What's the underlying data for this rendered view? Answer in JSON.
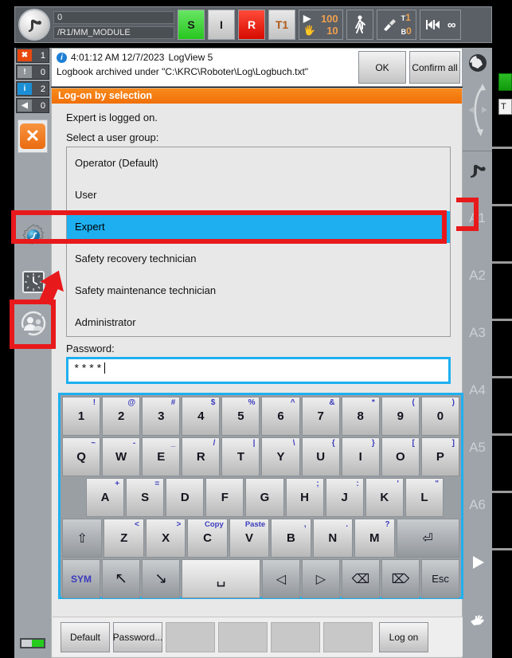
{
  "statusbar": {
    "robot_icon": "kuka-robot-icon",
    "program_number": "0",
    "program_path": "/R1/MM_MODULE",
    "buttons": [
      {
        "name": "submit-interpreter",
        "label": "S",
        "color": "#27c61f",
        "style": "green"
      },
      {
        "name": "drives-i",
        "label": "I",
        "color": "#c2c2c2",
        "style": "grey"
      },
      {
        "name": "drives-r",
        "label": "R",
        "color": "#d60b00",
        "style": "red"
      },
      {
        "name": "operating-mode",
        "label": "T1",
        "color": "#b05a18",
        "style": "mode"
      }
    ],
    "override": {
      "program_icon": "play-icon",
      "program_value": "100",
      "jog_icon": "hand-icon",
      "jog_value": "10"
    },
    "jog_mode_icon": "walking-person-icon",
    "tool_base": {
      "icon": "tool-icon",
      "tool_label": "T",
      "tool_value": "1",
      "base_label": "B",
      "base_value": "0"
    },
    "incremental_icon": "increment-jog-icon",
    "incremental_value": "∞"
  },
  "left_rail": {
    "message_counters": [
      {
        "name": "error-counter",
        "icon": "error-icon",
        "count": "1",
        "kind": "err"
      },
      {
        "name": "warning-counter",
        "icon": "warning-icon",
        "count": "0",
        "kind": "warn"
      },
      {
        "name": "info-counter",
        "icon": "info-icon",
        "count": "2",
        "kind": "info"
      },
      {
        "name": "wait-counter",
        "icon": "wait-icon",
        "count": "0",
        "kind": "wait"
      }
    ],
    "close_button_icon": "close-x-icon",
    "icons": [
      {
        "name": "settings-gear-icon"
      },
      {
        "name": "clock-icon"
      },
      {
        "name": "user-group-icon"
      }
    ],
    "battery_icon": "battery-indicator"
  },
  "right_rail": {
    "globe_icon": "world-coordinates-icon",
    "motion_icon": "reorient-arrows-icon",
    "robot_icon": "robot-axis-icon",
    "axes": [
      "A1",
      "A2",
      "A3",
      "A4",
      "A5",
      "A6"
    ],
    "play_icon": "play-triangle-icon",
    "hand_icon": "jog-hand-icon",
    "green_status": "drives-ready-indicator",
    "t_label": "T"
  },
  "message": {
    "info_icon": "info-icon",
    "timestamp": "4:01:12 AM 12/7/2023",
    "source": "LogView 5",
    "text": "Logbook archived under \"C:\\KRC\\Roboter\\Log\\Logbuch.txt\"",
    "ok_label": "OK",
    "confirm_all_label": "Confirm all"
  },
  "dialog": {
    "title": "Log-on by selection",
    "logged_on_text": "Expert is logged on.",
    "select_label": "Select a user group:",
    "user_groups": [
      {
        "label": "Operator (Default)",
        "selected": false
      },
      {
        "label": "User",
        "selected": false
      },
      {
        "label": "Expert",
        "selected": true
      },
      {
        "label": "Safety recovery technician",
        "selected": false
      },
      {
        "label": "Safety maintenance technician",
        "selected": false
      },
      {
        "label": "Administrator",
        "selected": false
      }
    ],
    "password_label": "Password:",
    "password_value": "****",
    "buttons": [
      {
        "name": "default-button",
        "label": "Default",
        "empty": false
      },
      {
        "name": "password-button",
        "label": "Password...",
        "empty": false
      },
      {
        "name": "softkey-3",
        "label": "",
        "empty": true
      },
      {
        "name": "softkey-4",
        "label": "",
        "empty": true
      },
      {
        "name": "softkey-5",
        "label": "",
        "empty": true
      },
      {
        "name": "softkey-6",
        "label": "",
        "empty": true
      },
      {
        "name": "log-on-button",
        "label": "Log on",
        "empty": false
      }
    ]
  },
  "keyboard": {
    "rows": [
      {
        "name": "number-row",
        "keys": [
          {
            "main": "1",
            "alt": "!"
          },
          {
            "main": "2",
            "alt": "@"
          },
          {
            "main": "3",
            "alt": "#"
          },
          {
            "main": "4",
            "alt": "$"
          },
          {
            "main": "5",
            "alt": "%"
          },
          {
            "main": "6",
            "alt": "^"
          },
          {
            "main": "7",
            "alt": "&"
          },
          {
            "main": "8",
            "alt": "*"
          },
          {
            "main": "9",
            "alt": "("
          },
          {
            "main": "0",
            "alt": ")"
          }
        ]
      },
      {
        "name": "qwerty-row",
        "keys": [
          {
            "main": "Q",
            "alt": "~"
          },
          {
            "main": "W",
            "alt": "-"
          },
          {
            "main": "E",
            "alt": "_"
          },
          {
            "main": "R",
            "alt": "/"
          },
          {
            "main": "T",
            "alt": "|"
          },
          {
            "main": "Y",
            "alt": "\\"
          },
          {
            "main": "U",
            "alt": "{"
          },
          {
            "main": "I",
            "alt": "}"
          },
          {
            "main": "O",
            "alt": "["
          },
          {
            "main": "P",
            "alt": "]"
          }
        ]
      },
      {
        "name": "home-row",
        "keys": [
          {
            "main": "A",
            "alt": "+"
          },
          {
            "main": "S",
            "alt": "="
          },
          {
            "main": "D",
            "alt": ""
          },
          {
            "main": "F",
            "alt": ""
          },
          {
            "main": "G",
            "alt": ""
          },
          {
            "main": "H",
            "alt": ";"
          },
          {
            "main": "J",
            "alt": ":"
          },
          {
            "main": "K",
            "alt": "'"
          },
          {
            "main": "L",
            "alt": "\""
          }
        ]
      },
      {
        "name": "zxcv-row",
        "keys": [
          {
            "main": "⇧",
            "alt": "",
            "icon": "shift-icon",
            "dark": true
          },
          {
            "main": "Z",
            "alt": "<"
          },
          {
            "main": "X",
            "alt": ">"
          },
          {
            "main": "C",
            "alt": "Copy"
          },
          {
            "main": "V",
            "alt": "Paste"
          },
          {
            "main": "B",
            "alt": ","
          },
          {
            "main": "N",
            "alt": "."
          },
          {
            "main": "M",
            "alt": "?"
          },
          {
            "main": "⏎",
            "alt": "",
            "icon": "enter-icon",
            "dark": true
          }
        ]
      },
      {
        "name": "bottom-row",
        "keys": [
          {
            "main": "SYM",
            "alt": "",
            "icon": "symbol-icon",
            "dark": true
          },
          {
            "main": "↖",
            "alt": "",
            "icon": "home-icon",
            "dark": true
          },
          {
            "main": "↘",
            "alt": "",
            "icon": "end-icon",
            "dark": true
          },
          {
            "main": "␣",
            "alt": "",
            "icon": "space-icon",
            "space": true
          },
          {
            "main": "◁",
            "alt": "",
            "icon": "arrow-left-icon",
            "dark": true
          },
          {
            "main": "▷",
            "alt": "",
            "icon": "arrow-right-icon",
            "dark": true
          },
          {
            "main": "⌫",
            "alt": "",
            "icon": "backspace-icon",
            "dark": true
          },
          {
            "main": "⌦",
            "alt": "",
            "icon": "delete-icon",
            "dark": true
          },
          {
            "main": "Esc",
            "alt": "",
            "icon": "escape-icon",
            "dark": true
          }
        ]
      }
    ]
  },
  "annotations": {
    "accent_red": "#e8191b",
    "highlight_blue": "#1eaff0",
    "orange": "#f06f08"
  }
}
